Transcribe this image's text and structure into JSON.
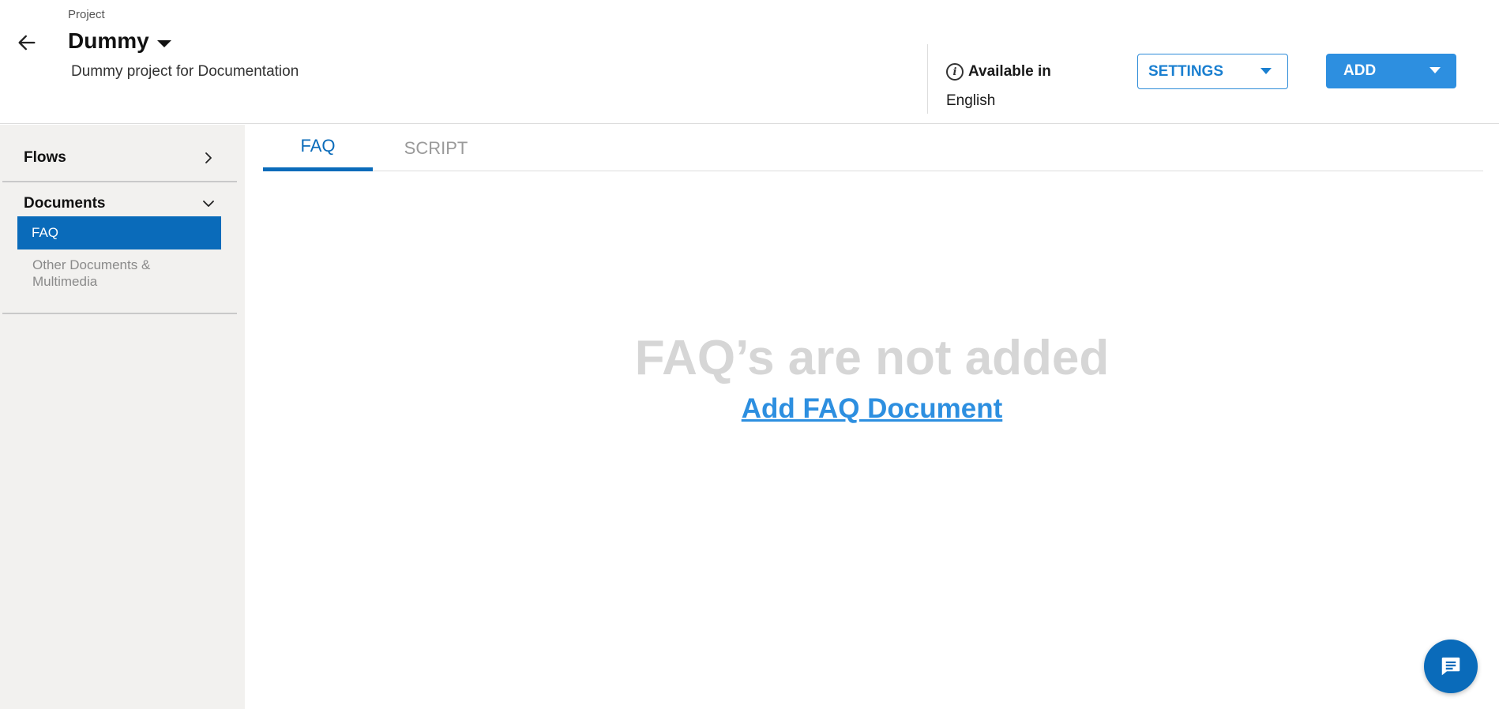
{
  "header": {
    "back_icon": "arrow-left-icon",
    "project_label": "Project",
    "project_name": "Dummy",
    "project_description": "Dummy project for Documentation",
    "available_label": "Available in",
    "language": "English",
    "settings_label": "SETTINGS",
    "add_label": "ADD"
  },
  "sidebar": {
    "sections": [
      {
        "label": "Flows",
        "icon": "chevron-right-icon",
        "expanded": false
      },
      {
        "label": "Documents",
        "icon": "chevron-down-icon",
        "expanded": true,
        "items": [
          {
            "label": "FAQ",
            "active": true
          },
          {
            "label": "Other Documents & Multimedia",
            "active": false
          }
        ]
      }
    ]
  },
  "tabs": [
    {
      "label": "FAQ",
      "active": true
    },
    {
      "label": "SCRIPT",
      "active": false
    }
  ],
  "empty_state": {
    "title": "FAQ’s are not added",
    "action_label": "Add FAQ Document"
  },
  "chat_button": {
    "icon": "chat-icon"
  },
  "colors": {
    "primary": "#0a6bba",
    "accent": "#2d8fe0",
    "sidebar_bg": "#f2f1ef",
    "muted_text": "#d6d6d6"
  }
}
